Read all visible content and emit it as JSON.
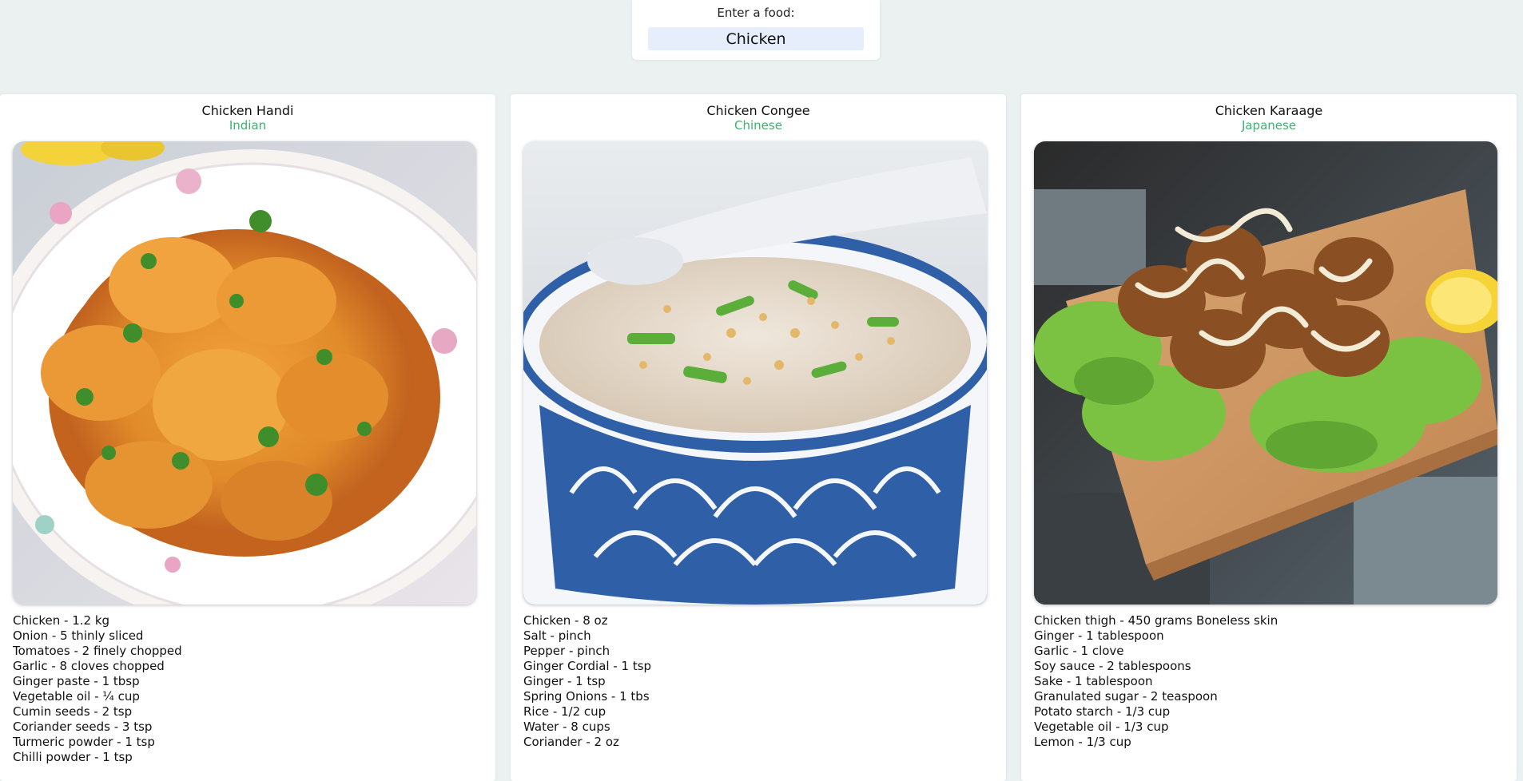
{
  "search": {
    "label": "Enter a food:",
    "value": "Chicken"
  },
  "recipes": [
    {
      "name": "Chicken Handi",
      "cuisine": "Indian",
      "image": "chicken-handi-curry-photo",
      "ingredients": [
        "Chicken - 1.2 kg",
        "Onion - 5 thinly sliced",
        "Tomatoes - 2 finely chopped",
        "Garlic - 8 cloves chopped",
        "Ginger paste - 1 tbsp",
        "Vegetable oil - ¼ cup",
        "Cumin seeds - 2 tsp",
        "Coriander seeds - 3 tsp",
        "Turmeric powder - 1 tsp",
        "Chilli powder - 1 tsp"
      ]
    },
    {
      "name": "Chicken Congee",
      "cuisine": "Chinese",
      "image": "chicken-congee-bowl-photo",
      "ingredients": [
        "Chicken - 8 oz",
        "Salt - pinch",
        "Pepper - pinch",
        "Ginger Cordial - 1 tsp",
        "Ginger - 1 tsp",
        "Spring Onions - 1 tbs",
        "Rice - 1/2 cup",
        "Water - 8 cups",
        "Coriander - 2 oz"
      ]
    },
    {
      "name": "Chicken Karaage",
      "cuisine": "Japanese",
      "image": "chicken-karaage-board-photo",
      "ingredients": [
        "Chicken thigh - 450 grams Boneless skin",
        "Ginger - 1 tablespoon",
        "Garlic - 1 clove",
        "Soy sauce - 2 tablespoons",
        "Sake - 1 tablespoon",
        "Granulated sugar - 2 teaspoon",
        "Potato starch - 1/3 cup",
        "Vegetable oil - 1/3 cup",
        "Lemon - 1/3 cup"
      ]
    }
  ],
  "colors": {
    "background": "#eaf1f0",
    "cuisine_text": "#3cb371",
    "input_background": "#e6eefb"
  }
}
